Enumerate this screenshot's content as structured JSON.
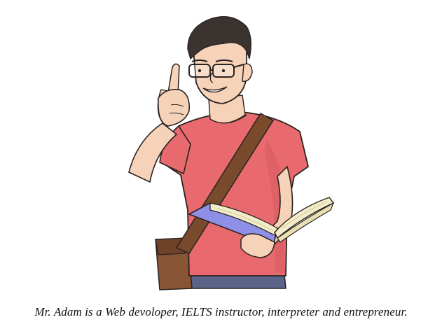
{
  "figure": {
    "caption": "Mr. Adam is a Web devoloper, IELTS instructor, interpreter and entrepreneur."
  },
  "colors": {
    "shirt": "#e86a6e",
    "shirt_shadow": "#d65a5e",
    "skin": "#f6d2b8",
    "skin_shadow": "#e8b898",
    "hair": "#3a3330",
    "strap": "#7a4a2c",
    "bag": "#8a5535",
    "book_cover": "#8e8fe6",
    "book_pages": "#f2ecc8",
    "jeans": "#5a6488",
    "outline": "#2a2220"
  }
}
